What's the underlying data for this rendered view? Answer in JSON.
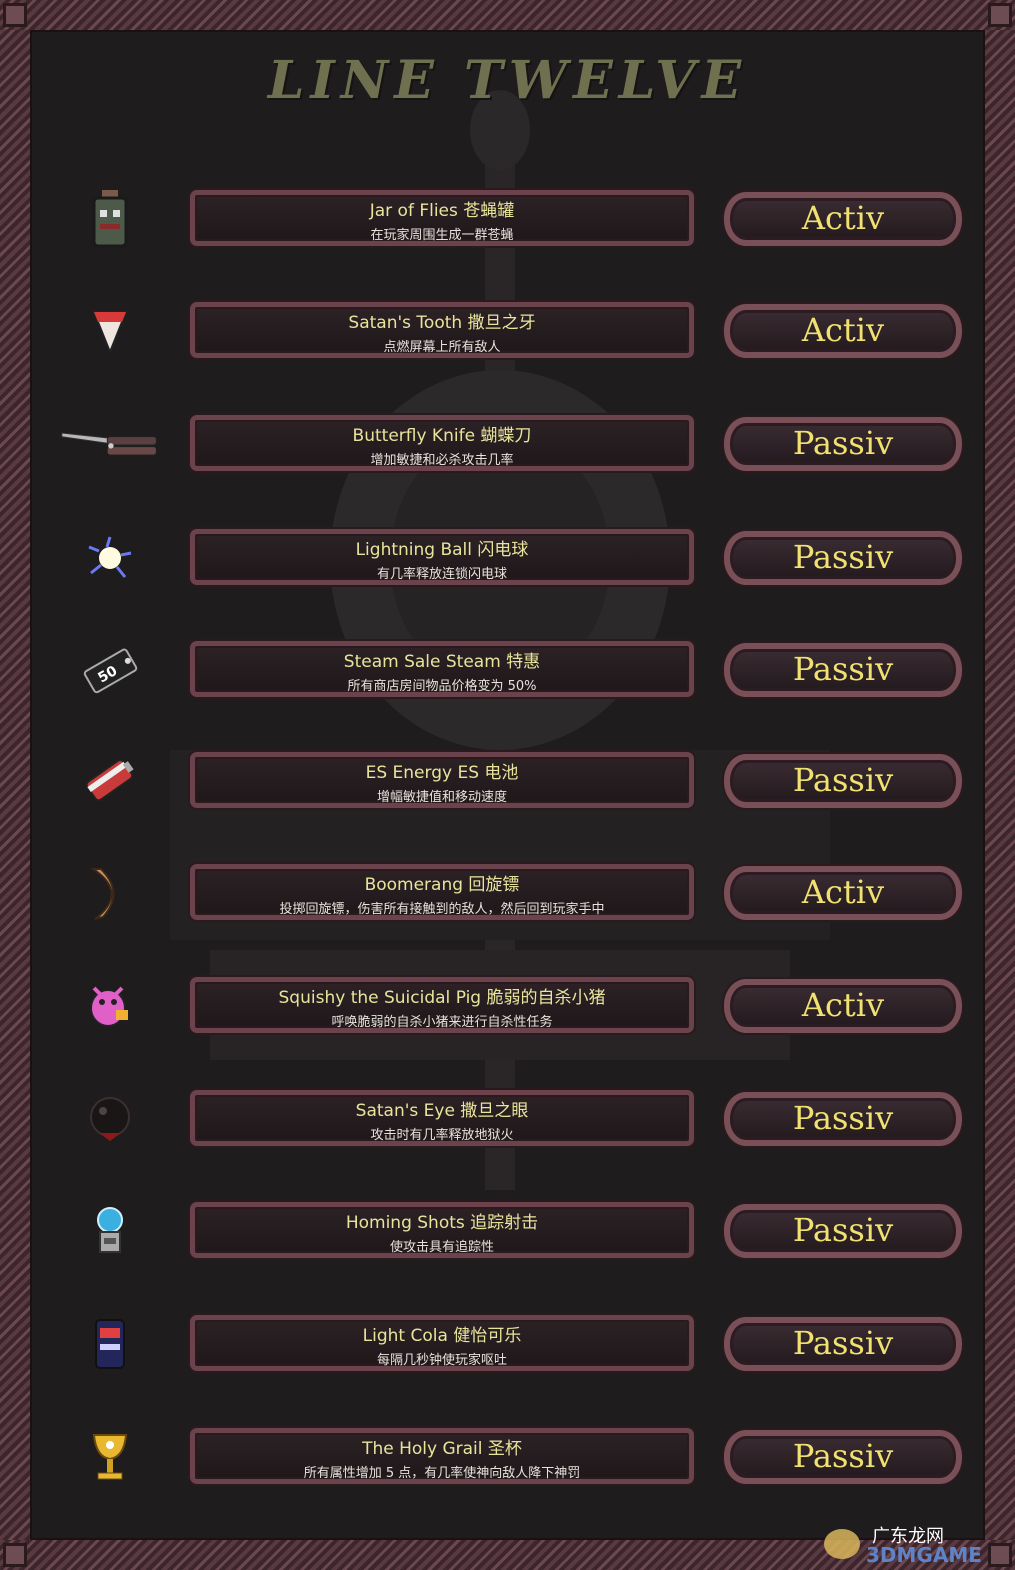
{
  "title": "LINE TWELVE",
  "items": [
    {
      "name": "Jar of Flies 苍蝇罐",
      "desc": "在玩家周围生成一群苍蝇",
      "type": "Activ",
      "icon": "jar-of-flies-icon"
    },
    {
      "name": "Satan's Tooth 撒旦之牙",
      "desc": "点燃屏幕上所有敌人",
      "type": "Activ",
      "icon": "satans-tooth-icon"
    },
    {
      "name": "Butterfly Knife 蝴蝶刀",
      "desc": "增加敏捷和必杀攻击几率",
      "type": "Passiv",
      "icon": "butterfly-knife-icon"
    },
    {
      "name": "Lightning Ball 闪电球",
      "desc": "有几率释放连锁闪电球",
      "type": "Passiv",
      "icon": "lightning-ball-icon"
    },
    {
      "name": "Steam Sale Steam 特惠",
      "desc": "所有商店房间物品价格变为 50%",
      "type": "Passiv",
      "icon": "steam-sale-icon"
    },
    {
      "name": "ES Energy ES 电池",
      "desc": "增幅敏捷值和移动速度",
      "type": "Passiv",
      "icon": "es-energy-icon"
    },
    {
      "name": "Boomerang 回旋镖",
      "desc": "投掷回旋镖，伤害所有接触到的敌人，然后回到玩家手中",
      "type": "Activ",
      "icon": "boomerang-icon"
    },
    {
      "name": "Squishy the Suicidal Pig 脆弱的自杀小猪",
      "desc": "呼唤脆弱的自杀小猪来进行自杀性任务",
      "type": "Activ",
      "icon": "suicidal-pig-icon"
    },
    {
      "name": "Satan's Eye 撒旦之眼",
      "desc": "攻击时有几率释放地狱火",
      "type": "Passiv",
      "icon": "satans-eye-icon"
    },
    {
      "name": "Homing Shots 追踪射击",
      "desc": "使攻击具有追踪性",
      "type": "Passiv",
      "icon": "homing-shots-icon"
    },
    {
      "name": "Light Cola 健怡可乐",
      "desc": "每隔几秒钟使玩家呕吐",
      "type": "Passiv",
      "icon": "light-cola-icon"
    },
    {
      "name": "The Holy Grail 圣杯",
      "desc": "所有属性增加 5 点，有几率使神向敌人降下神罚",
      "type": "Passiv",
      "icon": "holy-grail-icon"
    }
  ],
  "watermark": {
    "cn": "广东龙网",
    "en": "3DMGAME"
  },
  "colors": {
    "name": "#e9e49b",
    "type": "#f0e170",
    "frame": "#6a434c",
    "background": "#1f1c1d"
  }
}
